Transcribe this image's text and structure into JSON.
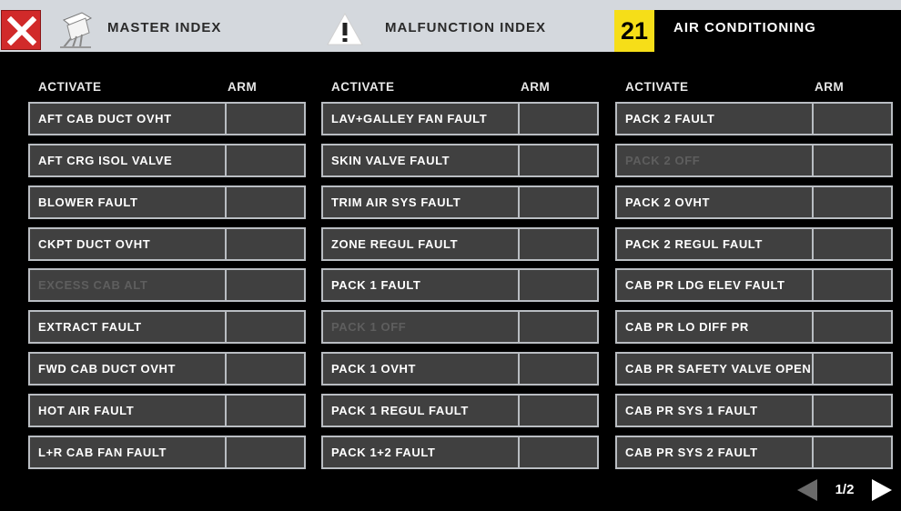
{
  "header": {
    "master_index_label": "MASTER INDEX",
    "malfunction_index_label": "MALFUNCTION INDEX",
    "chapter_number": "21",
    "chapter_title": "AIR CONDITIONING",
    "close_color": "#d12a2a",
    "badge_color": "#f6de18",
    "icons": [
      "close-icon",
      "aircraft-icon",
      "warning-icon"
    ]
  },
  "columns": [
    {
      "activate_header": "ACTIVATE",
      "arm_header": "ARM",
      "items": [
        {
          "label": "AFT CAB DUCT OVHT",
          "enabled": true
        },
        {
          "label": "AFT CRG ISOL VALVE",
          "enabled": true
        },
        {
          "label": "BLOWER FAULT",
          "enabled": true
        },
        {
          "label": "CKPT DUCT OVHT",
          "enabled": true
        },
        {
          "label": "EXCESS CAB ALT",
          "enabled": false
        },
        {
          "label": "EXTRACT FAULT",
          "enabled": true
        },
        {
          "label": "FWD CAB DUCT OVHT",
          "enabled": true
        },
        {
          "label": "HOT AIR FAULT",
          "enabled": true
        },
        {
          "label": "L+R CAB FAN FAULT",
          "enabled": true
        }
      ]
    },
    {
      "activate_header": "ACTIVATE",
      "arm_header": "ARM",
      "items": [
        {
          "label": "LAV+GALLEY FAN FAULT",
          "enabled": true
        },
        {
          "label": "SKIN VALVE FAULT",
          "enabled": true
        },
        {
          "label": "TRIM AIR SYS FAULT",
          "enabled": true
        },
        {
          "label": "ZONE REGUL FAULT",
          "enabled": true
        },
        {
          "label": "PACK 1 FAULT",
          "enabled": true
        },
        {
          "label": "PACK 1 OFF",
          "enabled": false
        },
        {
          "label": "PACK 1 OVHT",
          "enabled": true
        },
        {
          "label": "PACK 1 REGUL FAULT",
          "enabled": true
        },
        {
          "label": "PACK 1+2 FAULT",
          "enabled": true
        }
      ]
    },
    {
      "activate_header": "ACTIVATE",
      "arm_header": "ARM",
      "items": [
        {
          "label": "PACK 2 FAULT",
          "enabled": true
        },
        {
          "label": "PACK 2 OFF",
          "enabled": false
        },
        {
          "label": "PACK 2 OVHT",
          "enabled": true
        },
        {
          "label": "PACK 2 REGUL FAULT",
          "enabled": true
        },
        {
          "label": "CAB PR LDG ELEV FAULT",
          "enabled": true
        },
        {
          "label": "CAB PR LO DIFF PR",
          "enabled": true
        },
        {
          "label": "CAB PR SAFETY VALVE OPEN",
          "enabled": true
        },
        {
          "label": "CAB PR SYS 1 FAULT",
          "enabled": true
        },
        {
          "label": "CAB PR SYS 2 FAULT",
          "enabled": true
        }
      ]
    }
  ],
  "pagination": {
    "page_text": "1/2",
    "icons": [
      "prev-page-icon",
      "next-page-icon"
    ]
  }
}
